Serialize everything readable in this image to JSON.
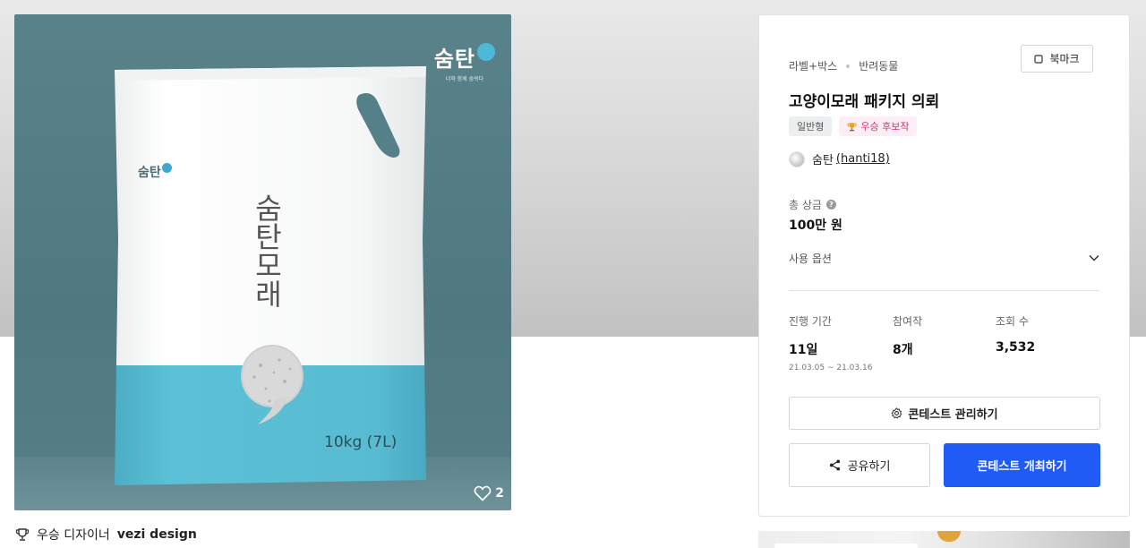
{
  "product_image": {
    "corner_logo": "숨탄",
    "corner_logo_tagline": "너와 함께 숨쉬다",
    "bag_logo": "숨탄",
    "bag_vertical_text": "숨탄모래",
    "bag_weight": "10kg (7L)",
    "likes": "2",
    "icons": [
      "heart-icon"
    ]
  },
  "winner": {
    "label": "우승 디자이너",
    "name": "vezi design",
    "icon": "trophy-icon"
  },
  "contest": {
    "breadcrumb": [
      "라벨+박스",
      "반려동물"
    ],
    "bookmark_label": "북마크",
    "title": "고양이모래 패키지 의뢰",
    "tags": {
      "type": "일반형",
      "badge": "우승 후보작"
    },
    "holder": {
      "name": "숨탄",
      "handle": "(hanti18)"
    },
    "prize_label": "총 상금",
    "prize_help": "?",
    "prize_value": "100만 원",
    "options_label": "사용 옵션",
    "stats": {
      "duration_label": "진행 기간",
      "duration_value": "11일",
      "duration_range": "21.03.05 ~ 21.03.16",
      "participants_label": "참여작",
      "participants_value": "8개",
      "views_label": "조회 수",
      "views_value": "3,532"
    },
    "manage_button": "콘테스트 관리하기",
    "share_button": "공유하기",
    "host_button": "콘테스트 개최하기"
  },
  "colors": {
    "primary": "#1f5bf4",
    "hero_bg": "#56808a",
    "bag_accent": "#55bdd3",
    "badge_pink": "#d0347a"
  }
}
